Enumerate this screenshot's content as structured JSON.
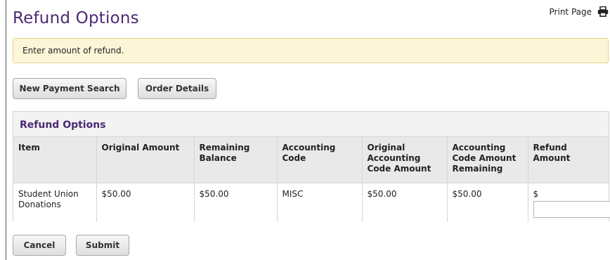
{
  "page": {
    "title": "Refund Options",
    "print_label": "Print Page",
    "print_icon": "printer-icon"
  },
  "alert": {
    "message": "Enter amount of refund."
  },
  "actions": {
    "new_payment_search": "New Payment Search",
    "order_details": "Order Details"
  },
  "panel": {
    "heading": "Refund Options",
    "columns": [
      "Item",
      "Original Amount",
      "Remaining Balance",
      "Accounting Code",
      "Original Accounting Code Amount",
      "Accounting Code Amount Remaining",
      "Refund Amount"
    ],
    "rows": [
      {
        "item": "Student Union Donations",
        "original_amount": "$50.00",
        "remaining_balance": "$50.00",
        "accounting_code": "MISC",
        "original_accounting_code_amount": "$50.00",
        "accounting_code_amount_remaining": "$50.00",
        "refund_currency": "$",
        "refund_value": ""
      }
    ]
  },
  "footer": {
    "cancel": "Cancel",
    "submit": "Submit"
  },
  "colors": {
    "title": "#4b2a73",
    "alert_background": "#fcf5d7",
    "alert_border": "#e8d38a"
  }
}
